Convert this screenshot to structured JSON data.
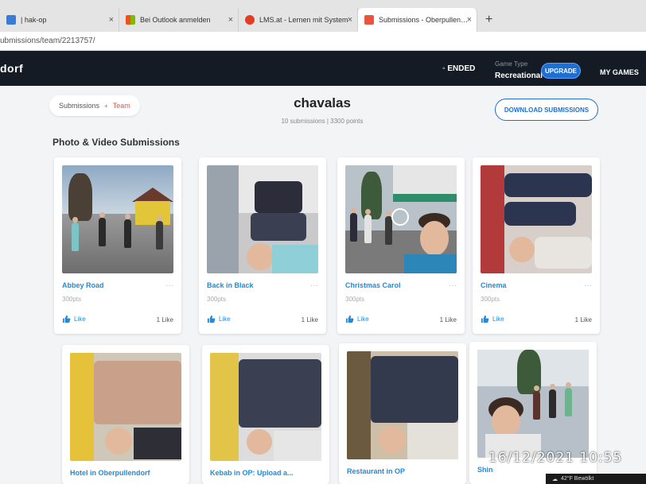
{
  "browser": {
    "tabs": [
      {
        "label": "| hak-op",
        "fav": "#3a7bd5"
      },
      {
        "label": "Bei Outlook anmelden",
        "fav": "#f25022"
      },
      {
        "label": "LMS.at - Lernen mit System",
        "fav": "#e23b26"
      },
      {
        "label": "Submissions - Oberpullendorf | C",
        "fav": "#e8553f"
      }
    ],
    "close_glyph": "×",
    "newtab_glyph": "+",
    "url": "ubmissions/team/2213757/"
  },
  "header": {
    "logo": "dorf",
    "status": "ENDED",
    "status_glyph": "◦",
    "game_type_label": "Game Type",
    "game_type_value": "Recreational",
    "upgrade": "UPGRADE",
    "my_games": "MY GAMES"
  },
  "breadcrumb": {
    "submissions": "Submissions",
    "sep": "+",
    "team": "Team"
  },
  "team": {
    "name": "chavalas",
    "stats": "10 submissions | 3300 points"
  },
  "download": "DOWNLOAD SUBMISSIONS",
  "section_title": "Photo & Video Submissions",
  "cards": [
    {
      "title": "Abbey Road",
      "points": "300pts",
      "like": "Like",
      "likes": "1 Like",
      "more": "···"
    },
    {
      "title": "Back in Black",
      "points": "300pts",
      "like": "Like",
      "likes": "1 Like",
      "more": "···"
    },
    {
      "title": "Christmas Carol",
      "points": "300pts",
      "like": "Like",
      "likes": "1 Like",
      "more": "···"
    },
    {
      "title": "Cinema",
      "points": "300pts",
      "like": "Like",
      "likes": "1 Like",
      "more": "···"
    },
    {
      "title": "Hotel in Oberpullendorf",
      "points": "",
      "like": "",
      "likes": "",
      "more": ""
    },
    {
      "title": "Kebab in OP: Upload a...",
      "points": "",
      "like": "",
      "likes": "",
      "more": ""
    },
    {
      "title": "Restaurant in OP",
      "points": "",
      "like": "",
      "likes": "",
      "more": ""
    },
    {
      "title": "Shin",
      "points": "",
      "like": "",
      "likes": "",
      "more": ""
    }
  ],
  "overlay_timestamp": "16/12/2021  10:55",
  "taskbar": {
    "weather": "42°F  Bewölkt"
  },
  "colors": {
    "accent": "#1e6fd1",
    "link": "#1e8be0",
    "team": "#e8553f",
    "header_bg": "#141b24"
  }
}
